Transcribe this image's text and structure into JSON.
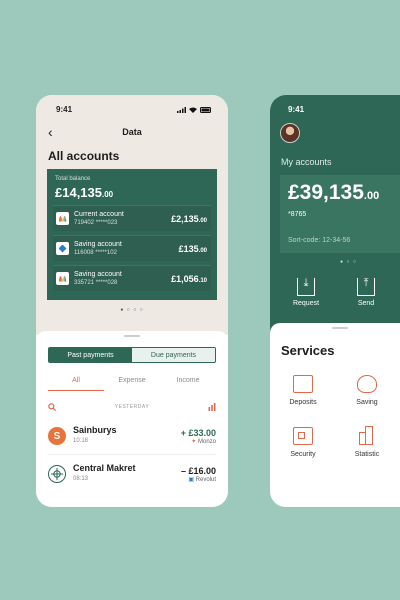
{
  "phone1": {
    "status_time": "9:41",
    "nav_title": "Data",
    "heading": "All accounts",
    "total_label": "Total balance",
    "total_main": "£14,135",
    "total_cents": ".00",
    "accounts": [
      {
        "name": "Current account",
        "number": "719402  *****023",
        "amount": "£2,135",
        "cents": ".00",
        "icon": "monzo-icon"
      },
      {
        "name": "Saving account",
        "number": "116008  *****102",
        "amount": "£135",
        "cents": ".00",
        "icon": "bank-icon"
      },
      {
        "name": "Saving account",
        "number": "335721  *****028",
        "amount": "£1,056",
        "cents": ".10",
        "icon": "monzo-icon"
      }
    ],
    "segments": [
      "Past payments",
      "Due payments"
    ],
    "tabs": [
      "All",
      "Expense",
      "Income"
    ],
    "day_label": "YESTERDAY",
    "transactions": [
      {
        "name": "Sainburys",
        "time": "10:18",
        "amount": "+ £33.00",
        "bank": "Monzo",
        "logo": "S",
        "color": "#e8733d"
      },
      {
        "name": "Central Makret",
        "time": "08:13",
        "amount": "– £16.00",
        "bank": "Revolut",
        "logo": "",
        "color": "#ffffff"
      }
    ],
    "pager_dots": "● ○ ○ ○"
  },
  "phone2": {
    "status_time": "9:41",
    "my_accounts": "My accounts",
    "balance_main": "£39,135",
    "balance_cents": ".00",
    "card_number": "*8765",
    "sort_code": "Sort-code: 12-34-56",
    "pager_dots": "● ○ ○",
    "actions": [
      "Request",
      "Send"
    ],
    "services_title": "Services",
    "services": [
      "Deposits",
      "Saving",
      "Security",
      "Statistic"
    ]
  }
}
